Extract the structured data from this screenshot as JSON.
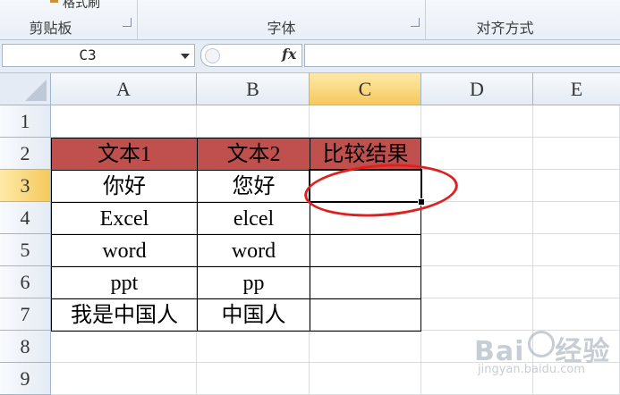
{
  "ribbon": {
    "groups": [
      {
        "id": "clipboard",
        "label": "剪贴板"
      },
      {
        "id": "font",
        "label": "字体"
      },
      {
        "id": "alignment",
        "label": "对齐方式"
      }
    ],
    "format_painter_label": "格式刷"
  },
  "formula_bar": {
    "name_box": "C3",
    "fx_label": "fx",
    "formula": ""
  },
  "columns": [
    "A",
    "B",
    "C",
    "D",
    "E"
  ],
  "rows": [
    "1",
    "2",
    "3",
    "4",
    "5",
    "6",
    "7",
    "8",
    "9"
  ],
  "active_cell": {
    "column": "C",
    "row": "3"
  },
  "table": {
    "headers": [
      "文本1",
      "文本2",
      "比较结果"
    ],
    "rows": [
      [
        "你好",
        "您好",
        ""
      ],
      [
        "Excel",
        "elcel",
        ""
      ],
      [
        "word",
        "word",
        ""
      ],
      [
        "ppt",
        "pp",
        ""
      ],
      [
        "我是中国人",
        "中国人",
        ""
      ]
    ],
    "header_color": "#C0504D"
  },
  "annotation": {
    "color": "#E01F1F",
    "shape": "ellipse"
  },
  "watermark": {
    "brand": "Bai",
    "brand2": "经验",
    "sub": "jingyan.baidu.com"
  }
}
